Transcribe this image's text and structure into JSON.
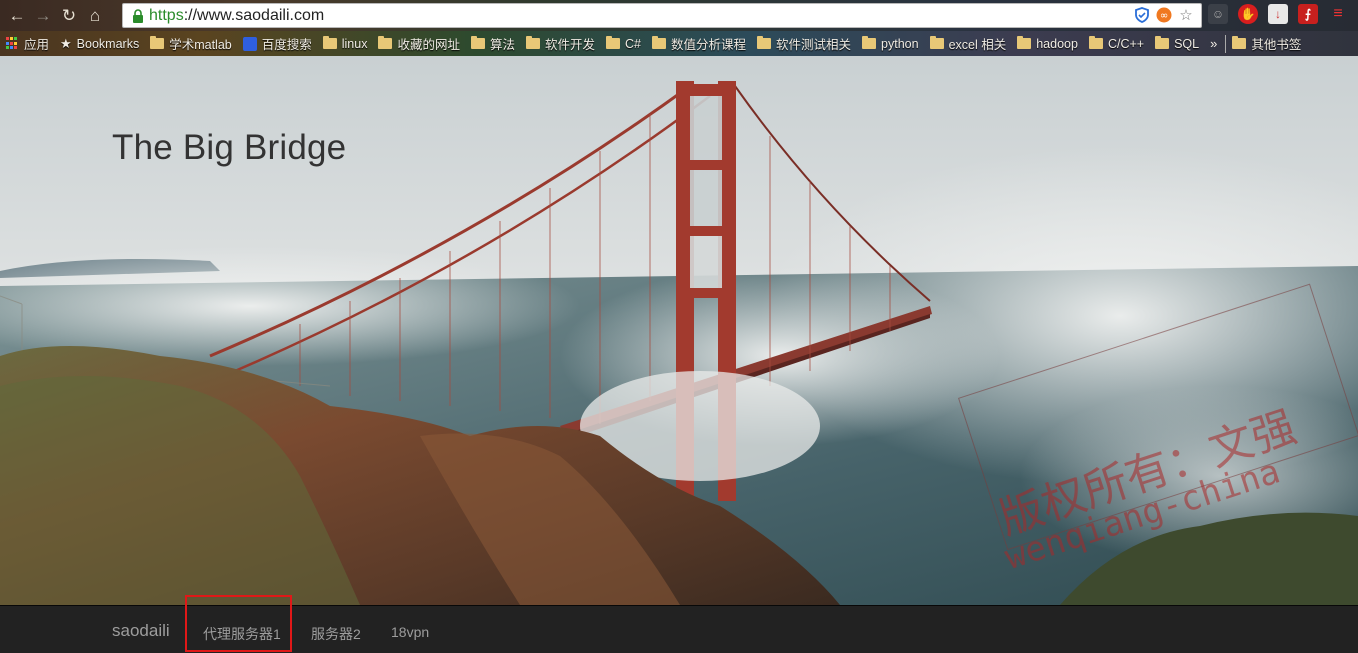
{
  "browser": {
    "url_scheme": "https",
    "url_rest": "://www.saodaili.com",
    "bookmarks": [
      {
        "label": "应用",
        "icon": "apps-grid-icon"
      },
      {
        "label": "Bookmarks",
        "icon": "star-icon"
      },
      {
        "label": "学术matlab",
        "icon": "folder-icon"
      },
      {
        "label": "百度搜索",
        "icon": "baidu-icon"
      },
      {
        "label": "linux",
        "icon": "folder-icon"
      },
      {
        "label": "收藏的网址",
        "icon": "folder-icon"
      },
      {
        "label": "算法",
        "icon": "folder-icon"
      },
      {
        "label": "软件开发",
        "icon": "folder-icon"
      },
      {
        "label": "C#",
        "icon": "folder-icon"
      },
      {
        "label": "数值分析课程",
        "icon": "folder-icon"
      },
      {
        "label": "软件测试相关",
        "icon": "folder-icon"
      },
      {
        "label": "python",
        "icon": "folder-icon"
      },
      {
        "label": "excel 相关",
        "icon": "folder-icon"
      },
      {
        "label": "hadoop",
        "icon": "folder-icon"
      },
      {
        "label": "C/C++",
        "icon": "folder-icon"
      },
      {
        "label": "SQL",
        "icon": "folder-icon"
      }
    ],
    "overflow_label": "»",
    "other_bookmarks": "其他书签"
  },
  "hero": {
    "title": "The Big Bridge",
    "watermark_line1": "版权所有：文强",
    "watermark_line2": "wenqiang-china"
  },
  "navbar": {
    "brand": "saodaili",
    "links": [
      {
        "label": "代理服务器1",
        "highlighted": true
      },
      {
        "label": "服务器2"
      },
      {
        "label": "18vpn"
      }
    ]
  },
  "colors": {
    "navbar_bg": "#222222",
    "nav_text": "#9d9d9d",
    "highlight_box": "#e01818",
    "bridge_red": "#a23a2e"
  }
}
